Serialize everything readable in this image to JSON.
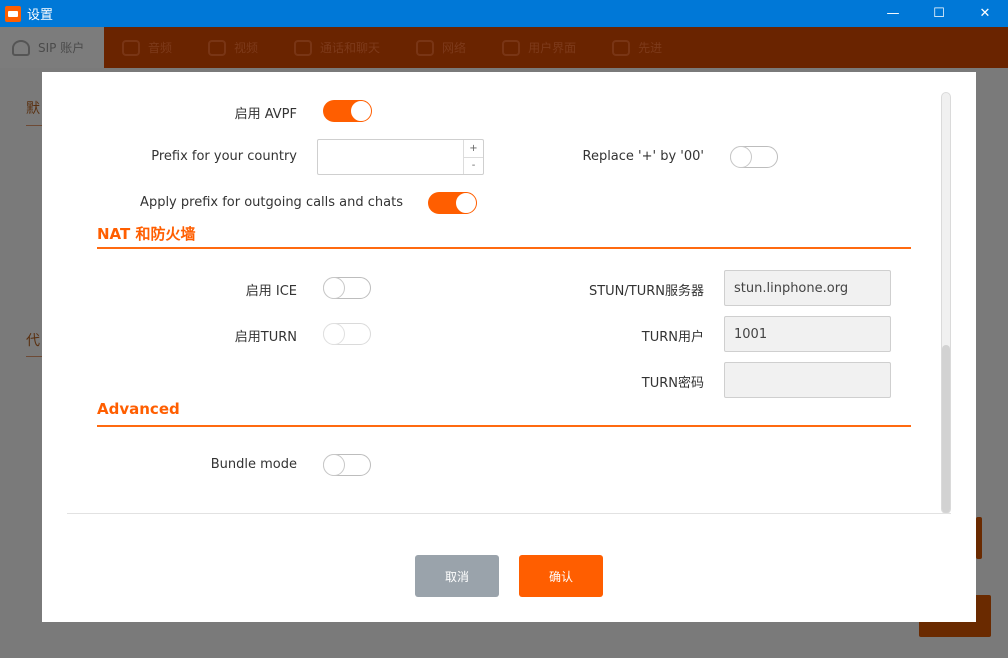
{
  "window": {
    "title": "设置",
    "minimize": "—",
    "maximize": "☐",
    "close": "✕"
  },
  "tabs": [
    {
      "label": "SIP 账户",
      "icon": "user-icon"
    },
    {
      "label": "音频",
      "icon": "speaker-icon"
    },
    {
      "label": "视频",
      "icon": "camera-icon"
    },
    {
      "label": "通话和聊天",
      "icon": "phone-icon"
    },
    {
      "label": "网络",
      "icon": "share-icon"
    },
    {
      "label": "用户界面",
      "icon": "gear-icon"
    },
    {
      "label": "先进",
      "icon": "gear-icon"
    }
  ],
  "background": {
    "frag1": "默",
    "frag2": "代"
  },
  "modal": {
    "avpf": {
      "label": "启用 AVPF",
      "on": true
    },
    "prefix": {
      "label": "Prefix for your country",
      "value": "",
      "plus": "+",
      "minus": "-"
    },
    "replace_plus": {
      "label": "Replace '+' by '00'",
      "on": false
    },
    "apply_prefix": {
      "label": "Apply prefix for outgoing calls and chats",
      "on": true
    },
    "nat_section": {
      "title": "NAT 和防火墙"
    },
    "ice": {
      "label": "启用 ICE",
      "on": false
    },
    "turn": {
      "label": "启用TURN",
      "on": false
    },
    "stun_server": {
      "label": "STUN/TURN服务器",
      "value": "stun.linphone.org"
    },
    "turn_user": {
      "label": "TURN用户",
      "value": "1001"
    },
    "turn_password": {
      "label": "TURN密码",
      "value": ""
    },
    "advanced_section": {
      "title": "Advanced"
    },
    "bundle_mode": {
      "label": "Bundle mode",
      "on": false
    },
    "cancel_label": "取消",
    "ok_label": "确认"
  },
  "colors": {
    "accent": "#ff5e00",
    "titlebar": "#0078d7"
  }
}
